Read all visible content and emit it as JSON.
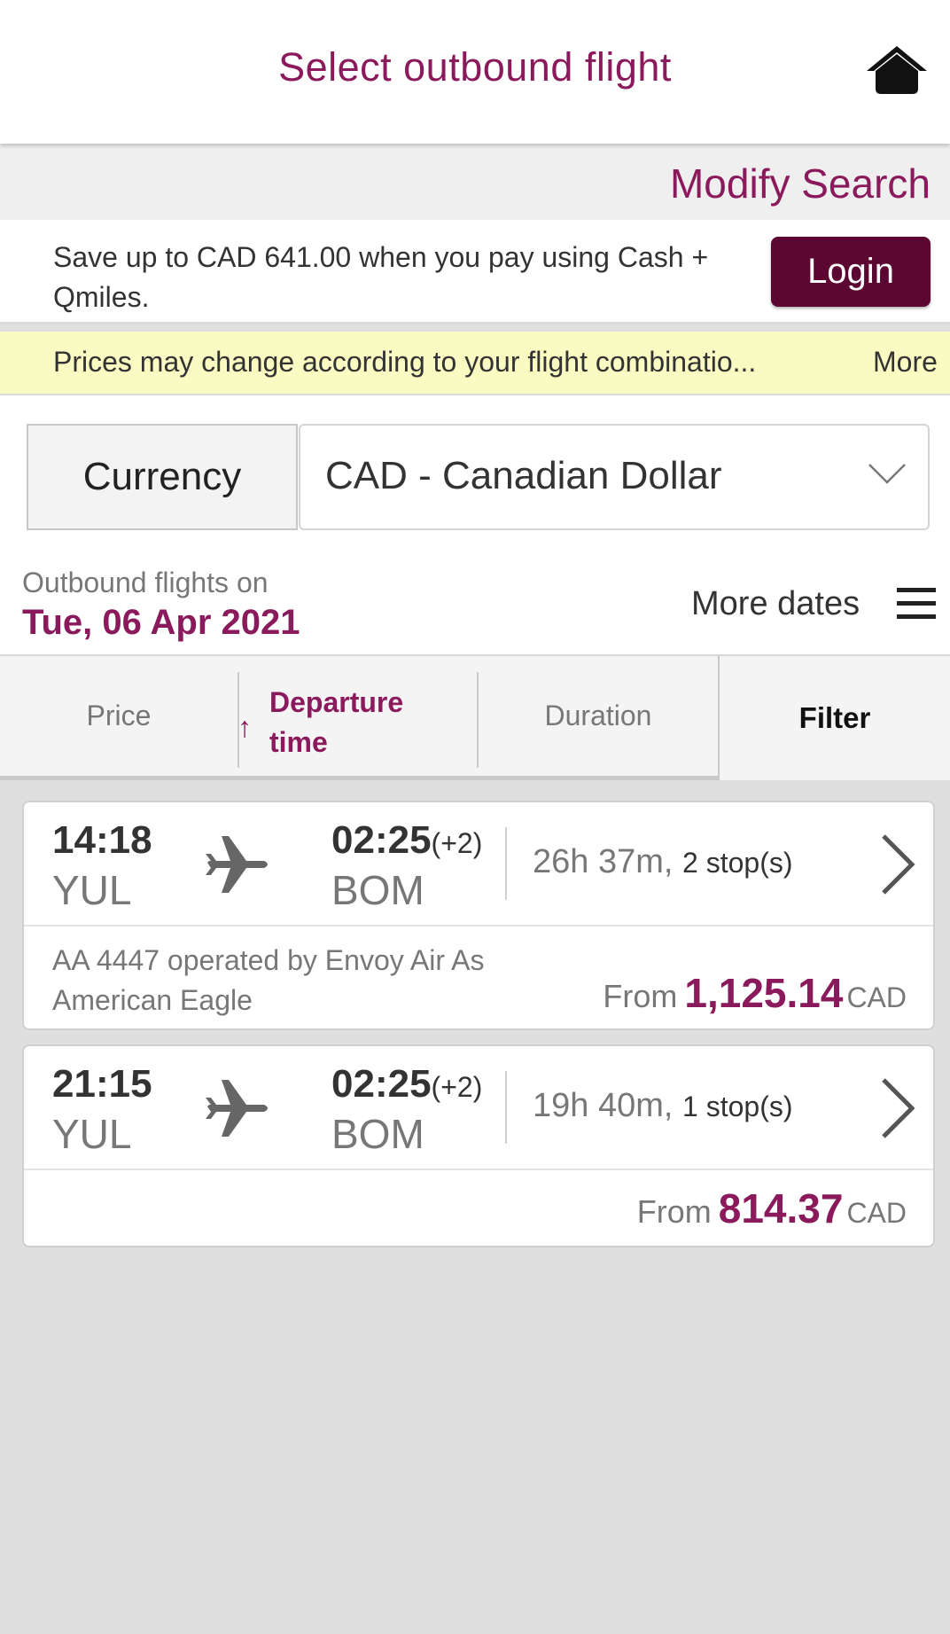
{
  "header": {
    "title": "Select outbound flight",
    "home_icon": "home-icon"
  },
  "modify": {
    "label": "Modify Search"
  },
  "promo": {
    "text": "Save up to CAD 641.00 when you pay using Cash + Qmiles.",
    "login_label": "Login"
  },
  "notice": {
    "text": "Prices may change according to your flight combinatio...",
    "more_label": "More"
  },
  "currency": {
    "label": "Currency",
    "value": "CAD - Canadian Dollar"
  },
  "outbound": {
    "label": "Outbound flights on",
    "date": "Tue, 06 Apr 2021",
    "more_dates": "More dates"
  },
  "sort": {
    "price": "Price",
    "departure_arrow": "↑",
    "departure": "Departure time",
    "duration": "Duration",
    "filter": "Filter"
  },
  "flights": [
    {
      "dep_time": "14:18",
      "dep_code": "YUL",
      "arr_time": "02:25",
      "arr_offset": "(+2)",
      "arr_code": "BOM",
      "duration": "26h 37m,",
      "stops": "2 stop(s)",
      "operator": "AA 4447 operated by Envoy Air As American Eagle",
      "from_label": "From",
      "price": "1,125.14",
      "currency": "CAD"
    },
    {
      "dep_time": "21:15",
      "dep_code": "YUL",
      "arr_time": "02:25",
      "arr_offset": "(+2)",
      "arr_code": "BOM",
      "duration": "19h 40m,",
      "stops": "1 stop(s)",
      "operator": "",
      "from_label": "From",
      "price": "814.37",
      "currency": "CAD"
    }
  ],
  "colors": {
    "brand": "#8a1a5c",
    "login_bg": "#5c0632",
    "notice_bg": "#fafbc2"
  }
}
